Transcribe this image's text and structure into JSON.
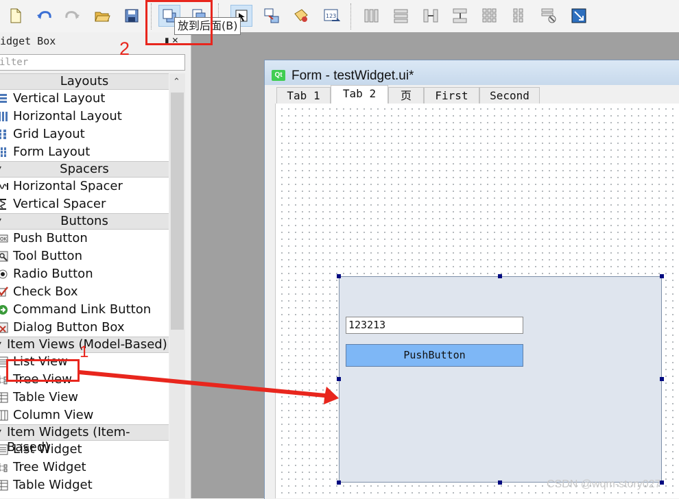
{
  "toolbar": {
    "tooltip": "放到后面(B)",
    "buttons": [
      "new-file",
      "undo",
      "redo",
      "open-file",
      "save",
      "send-to-back",
      "bring-to-front",
      "edit-widgets",
      "edit-signals-slots",
      "edit-buddies",
      "edit-tab-order",
      "layout-horizontally",
      "layout-vertically",
      "layout-horizontal-splitter",
      "layout-vertical-splitter",
      "layout-grid",
      "layout-form",
      "break-layout",
      "adjust-size"
    ]
  },
  "annotations": {
    "step_2": "2",
    "step_1": "1"
  },
  "widget_box": {
    "title": "idget Box",
    "filter_placeholder": "ilter",
    "categories": [
      {
        "label": "Layouts",
        "items": [
          "Vertical Layout",
          "Horizontal Layout",
          "Grid Layout",
          "Form Layout"
        ]
      },
      {
        "label": "Spacers",
        "items": [
          "Horizontal Spacer",
          "Vertical Spacer"
        ]
      },
      {
        "label": "Buttons",
        "items": [
          "Push Button",
          "Tool Button",
          "Radio Button",
          "Check Box",
          "Command Link Button",
          "Dialog Button Box"
        ]
      },
      {
        "label": "Item Views (Model-Based)",
        "items": [
          "List View",
          "Tree View",
          "Table View",
          "Column View"
        ]
      },
      {
        "label": "Item Widgets (Item-Based)",
        "items": [
          "List Widget",
          "Tree Widget",
          "Table Widget"
        ]
      }
    ]
  },
  "form": {
    "title": "Form - testWidget.ui*",
    "logo": "Qt",
    "tabs": [
      "Tab 1",
      "Tab 2",
      "页",
      "First",
      "Second"
    ],
    "selected_tab": 1,
    "line_edit_value": "123213",
    "push_button_label": "PushButton"
  },
  "watermark": "CSDN @wqm-story027"
}
